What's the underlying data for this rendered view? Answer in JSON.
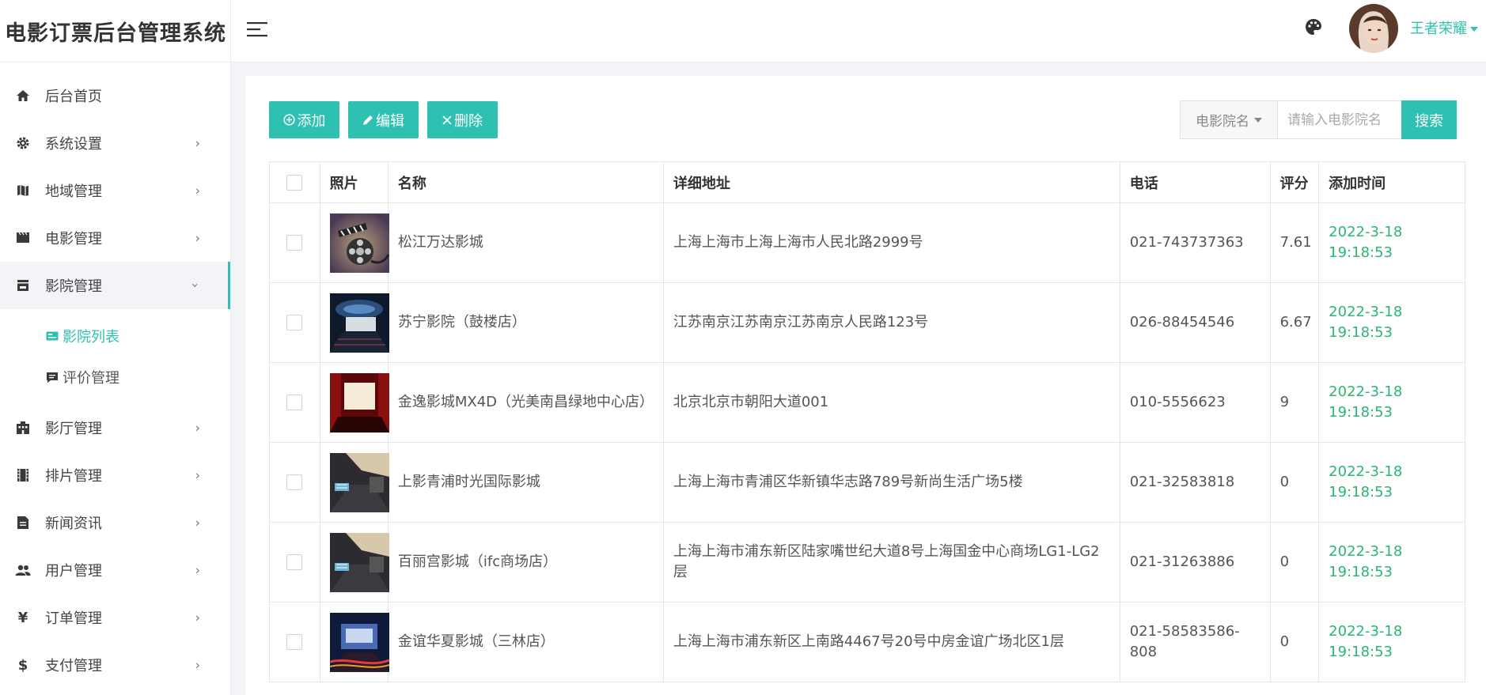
{
  "app": {
    "title": "电影订票后台管理系统",
    "accent": "#2ec1b1"
  },
  "sidebar": {
    "items": [
      {
        "label": "后台首页",
        "icon": "home-icon"
      },
      {
        "label": "系统设置",
        "icon": "gear-icon"
      },
      {
        "label": "地域管理",
        "icon": "map-icon"
      },
      {
        "label": "电影管理",
        "icon": "film-icon"
      },
      {
        "label": "影院管理",
        "icon": "store-icon"
      }
    ],
    "subitems": [
      {
        "label": "影院列表",
        "icon": "card-icon"
      },
      {
        "label": "评价管理",
        "icon": "comment-icon"
      }
    ],
    "items_after": [
      {
        "label": "影厅管理",
        "icon": "building-icon"
      },
      {
        "label": "排片管理",
        "icon": "schedule-icon"
      },
      {
        "label": "新闻资讯",
        "icon": "document-icon"
      },
      {
        "label": "用户管理",
        "icon": "users-icon"
      },
      {
        "label": "订单管理",
        "icon": "yen-icon"
      },
      {
        "label": "支付管理",
        "icon": "dollar-icon"
      }
    ]
  },
  "topbar": {
    "username": "王者荣耀"
  },
  "toolbar": {
    "add_label": "添加",
    "edit_label": "编辑",
    "delete_label": "删除"
  },
  "search": {
    "field_label": "电影院名",
    "placeholder": "请输入电影院名",
    "button_label": "搜索"
  },
  "table": {
    "headers": [
      "照片",
      "名称",
      "详细地址",
      "电话",
      "评分",
      "添加时间"
    ],
    "rows": [
      {
        "name": "松江万达影城",
        "address": "上海上海市上海上海市人民北路2999号",
        "phone": "021-743737363",
        "rating": "7.61",
        "time": "2022-3-18 19:18:53",
        "photo": "film-reel"
      },
      {
        "name": "苏宁影院（鼓楼店）",
        "address": "江苏南京江苏南京江苏南京人民路123号",
        "phone": "026-88454546",
        "rating": "6.67",
        "time": "2022-3-18 19:18:53",
        "photo": "theater-hall"
      },
      {
        "name": "金逸影城MX4D（光美南昌绿地中心店）",
        "address": "北京北京市朝阳大道001",
        "phone": "010-5556623",
        "rating": "9",
        "time": "2022-3-18 19:18:53",
        "photo": "red-screen"
      },
      {
        "name": "上影青浦时光国际影城",
        "address": "上海上海市青浦区华新镇华志路789号新尚生活广场5楼",
        "phone": "021-32583818",
        "rating": "0",
        "time": "2022-3-18 19:18:53",
        "photo": "imax-lobby"
      },
      {
        "name": "百丽宫影城（ifc商场店）",
        "address": "上海上海市浦东新区陆家嘴世纪大道8号上海国金中心商场LG1-LG2层",
        "phone": "021-31263886",
        "rating": "0",
        "time": "2022-3-18 19:18:53",
        "photo": "imax-lobby"
      },
      {
        "name": "金谊华夏影城（三林店）",
        "address": "上海上海市浦东新区上南路4467号20号中房金谊广场北区1层",
        "phone": "021-58583586-808",
        "rating": "0",
        "time": "2022-3-18 19:18:53",
        "photo": "night-building"
      }
    ]
  }
}
